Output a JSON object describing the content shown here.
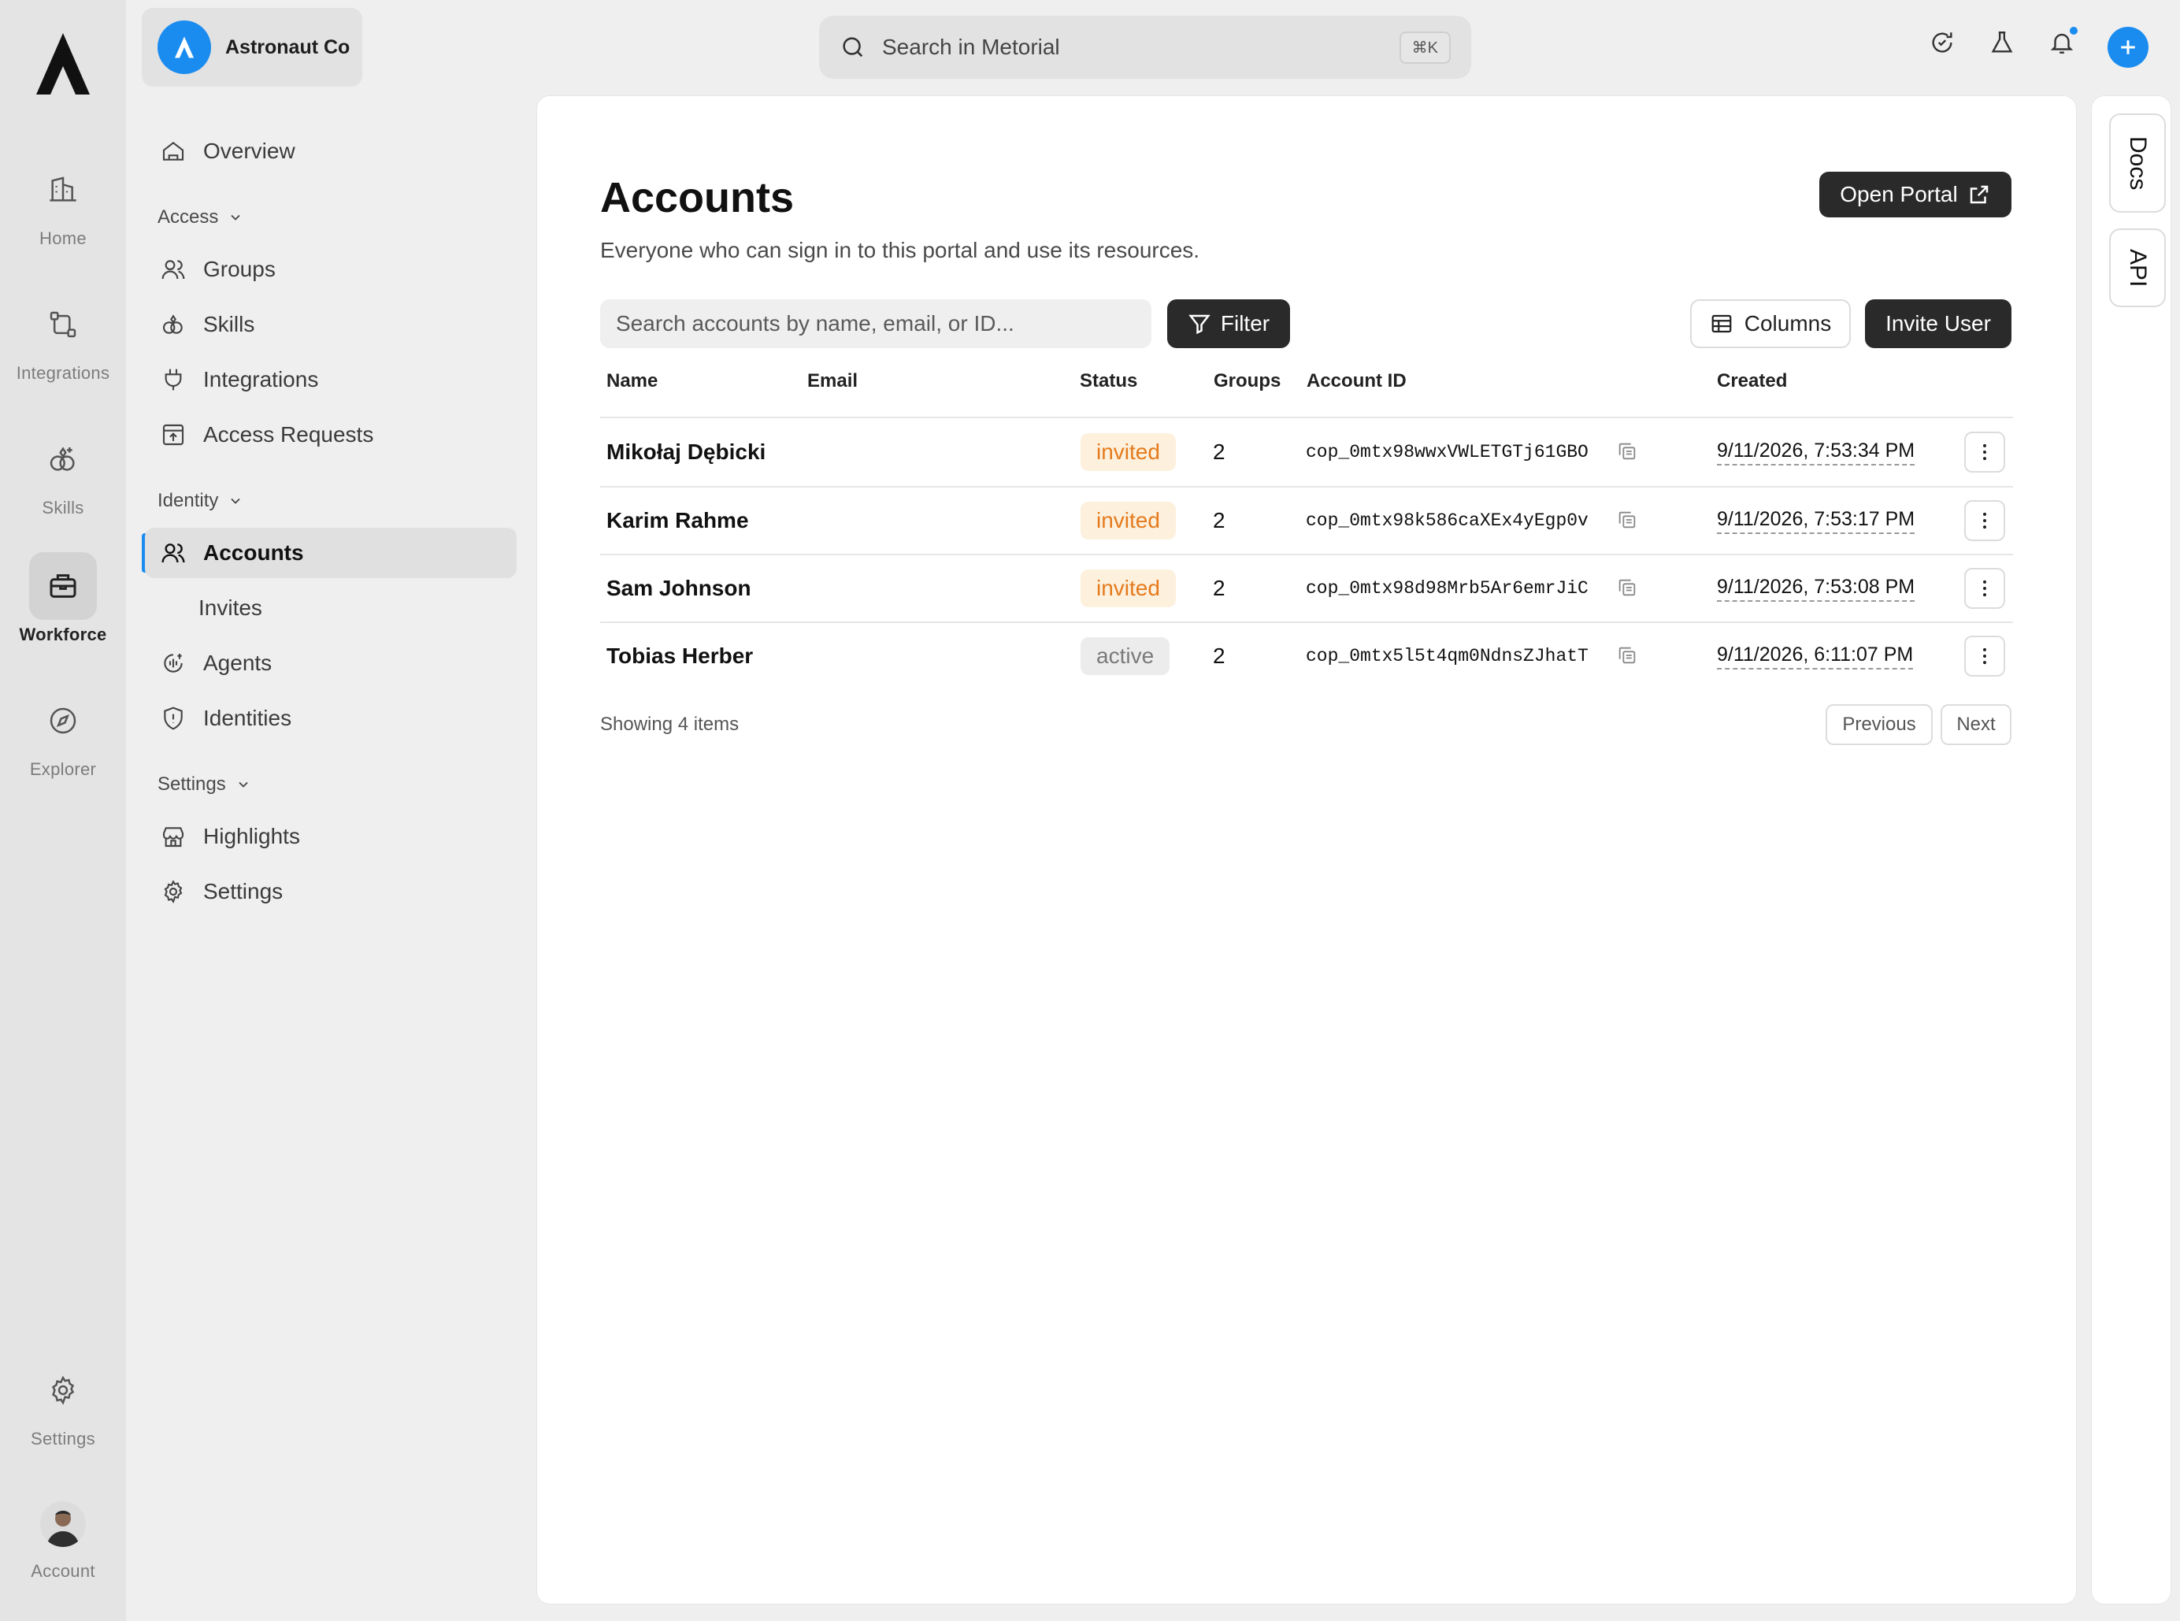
{
  "rail": {
    "items": [
      {
        "label": "Home",
        "icon": "building-icon"
      },
      {
        "label": "Integrations",
        "icon": "integration-nodes-icon"
      },
      {
        "label": "Skills",
        "icon": "shapes-icon"
      },
      {
        "label": "Workforce",
        "icon": "briefcase-icon"
      },
      {
        "label": "Explorer",
        "icon": "compass-icon"
      }
    ],
    "settings_label": "Settings",
    "account_label": "Account"
  },
  "sidebar": {
    "org_name": "Astronaut Co",
    "overview": "Overview",
    "sections": {
      "access": "Access",
      "identity": "Identity",
      "settings": "Settings"
    },
    "access_items": [
      "Groups",
      "Skills",
      "Integrations",
      "Access Requests"
    ],
    "identity_items": [
      "Accounts",
      "Invites",
      "Agents",
      "Identities"
    ],
    "settings_items": [
      "Highlights",
      "Settings"
    ]
  },
  "topbar": {
    "search_placeholder": "Search in Metorial",
    "search_shortcut": "⌘K"
  },
  "main": {
    "title": "Accounts",
    "subtitle": "Everyone who can sign in to this portal and use its resources.",
    "open_portal": "Open Portal",
    "search_placeholder": "Search accounts by name, email, or ID...",
    "filter": "Filter",
    "columns": "Columns",
    "invite_user": "Invite User",
    "table": {
      "headers": {
        "name": "Name",
        "email": "Email",
        "status": "Status",
        "groups": "Groups",
        "account_id": "Account ID",
        "created": "Created"
      },
      "rows": [
        {
          "name": "Mikołaj Dębicki",
          "email": "",
          "status": "invited",
          "groups": "2",
          "account_id": "cop_0mtx98wwxVWLETGTj61GBO",
          "created": "9/11/2026, 7:53:34 PM"
        },
        {
          "name": "Karim Rahme",
          "email": "",
          "status": "invited",
          "groups": "2",
          "account_id": "cop_0mtx98k586caXEx4yEgp0v",
          "created": "9/11/2026, 7:53:17 PM"
        },
        {
          "name": "Sam Johnson",
          "email": "",
          "status": "invited",
          "groups": "2",
          "account_id": "cop_0mtx98d98Mrb5Ar6emrJiC",
          "created": "9/11/2026, 7:53:08 PM"
        },
        {
          "name": "Tobias Herber",
          "email": "",
          "status": "active",
          "groups": "2",
          "account_id": "cop_0mtx5l5t4qm0NdnsZJhatT",
          "created": "9/11/2026, 6:11:07 PM"
        }
      ]
    },
    "showing": "Showing 4 items",
    "previous": "Previous",
    "next": "Next"
  },
  "right_tabs": {
    "docs": "Docs",
    "api": "API"
  },
  "colors": {
    "accent": "#1a8cf0",
    "invited_bg": "#fdf0dd",
    "invited_text": "#e57a1c",
    "active_bg": "#ececec",
    "dark_button": "#2a2a2a"
  }
}
